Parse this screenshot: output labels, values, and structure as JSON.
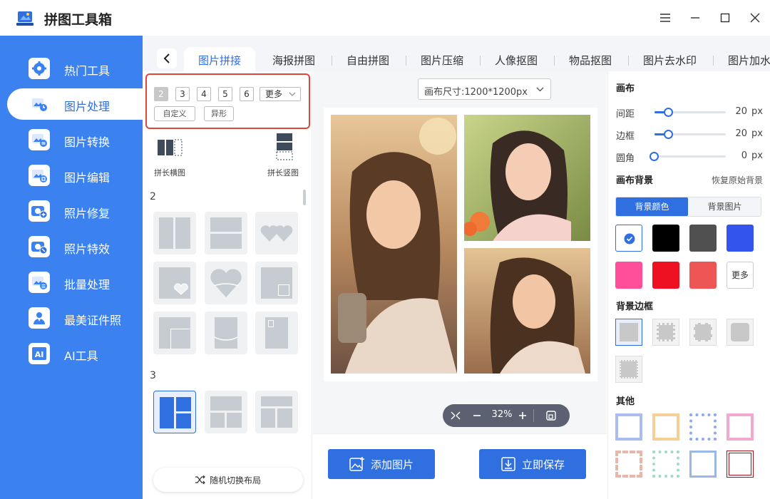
{
  "app": {
    "title": "拼图工具箱"
  },
  "sidebar": {
    "items": [
      {
        "label": "热门工具",
        "icon": "settings-icon"
      },
      {
        "label": "图片处理",
        "icon": "image-process-icon",
        "active": true
      },
      {
        "label": "图片转换",
        "icon": "image-convert-icon"
      },
      {
        "label": "图片编辑",
        "icon": "image-edit-icon"
      },
      {
        "label": "照片修复",
        "icon": "photo-repair-icon"
      },
      {
        "label": "照片特效",
        "icon": "photo-effect-icon"
      },
      {
        "label": "批量处理",
        "icon": "batch-icon"
      },
      {
        "label": "最美证件照",
        "icon": "id-photo-icon"
      },
      {
        "label": "AI工具",
        "icon": "ai-icon"
      }
    ]
  },
  "tabs": [
    {
      "label": "图片拼接",
      "active": true
    },
    {
      "label": "海报拼图"
    },
    {
      "label": "自由拼图"
    },
    {
      "label": "图片压缩"
    },
    {
      "label": "人像抠图"
    },
    {
      "label": "物品抠图"
    },
    {
      "label": "图片去水印"
    },
    {
      "label": "图片加水"
    }
  ],
  "layouts": {
    "counts": [
      "2",
      "3",
      "4",
      "5",
      "6"
    ],
    "more": "更多",
    "custom": "自定义",
    "special": "异形",
    "long_horizontal": "拼长横图",
    "long_vertical": "拼长竖图",
    "group2": "2",
    "group3": "3",
    "random": "随机切换布局"
  },
  "canvas": {
    "size_label": "画布尺寸:1200*1200px",
    "zoom": "32%",
    "add_image": "添加图片",
    "save": "立即保存"
  },
  "settings": {
    "canvas_title": "画布",
    "spacing": {
      "label": "间距",
      "value": "20",
      "unit": "px",
      "level": 0.2
    },
    "border": {
      "label": "边框",
      "value": "20",
      "unit": "px",
      "level": 0.2
    },
    "corner": {
      "label": "圆角",
      "value": "0",
      "unit": "px",
      "level": 0
    },
    "bg_title": "画布背景",
    "restore": "恢复原始背景",
    "bg_color_tab": "背景颜色",
    "bg_image_tab": "背景图片",
    "colors": [
      "#ffffff",
      "#000000",
      "#505050",
      "#3355ee",
      "#ff4f9a",
      "#ee1122",
      "#ee5555"
    ],
    "more": "更多",
    "frame_title": "背景边框",
    "other_title": "其他"
  }
}
